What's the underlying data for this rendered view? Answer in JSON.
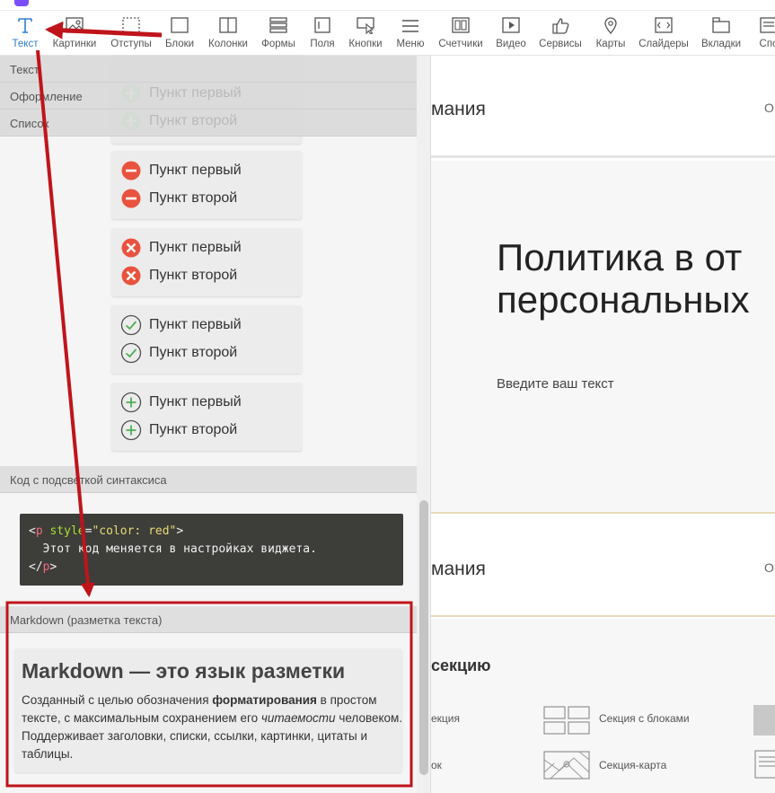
{
  "toolbar": {
    "items": [
      {
        "label": "Текст",
        "icon": "text-icon"
      },
      {
        "label": "Картинки",
        "icon": "image-icon"
      },
      {
        "label": "Отступы",
        "icon": "spacing-icon"
      },
      {
        "label": "Блоки",
        "icon": "block-icon"
      },
      {
        "label": "Колонки",
        "icon": "columns-icon"
      },
      {
        "label": "Формы",
        "icon": "form-icon"
      },
      {
        "label": "Поля",
        "icon": "field-icon"
      },
      {
        "label": "Кнопки",
        "icon": "button-icon"
      },
      {
        "label": "Меню",
        "icon": "menu-icon"
      },
      {
        "label": "Счетчики",
        "icon": "counter-icon"
      },
      {
        "label": "Видео",
        "icon": "video-icon"
      },
      {
        "label": "Сервисы",
        "icon": "thumbs-up-icon"
      },
      {
        "label": "Карты",
        "icon": "map-pin-icon"
      },
      {
        "label": "Слайдеры",
        "icon": "slider-icon"
      },
      {
        "label": "Вкладки",
        "icon": "tabs-icon"
      },
      {
        "label": "Спо",
        "icon": "list-icon"
      }
    ],
    "active_color": "#2d7fd1"
  },
  "panel": {
    "categories": [
      "Текст",
      "Оформление",
      "Список"
    ],
    "lists": [
      {
        "style": "plus-icon",
        "items": [
          "Пункт первый",
          "Пункт второй"
        ]
      },
      {
        "style": "minus-circle-icon",
        "items": [
          "Пункт первый",
          "Пункт второй"
        ]
      },
      {
        "style": "cross-circle-icon",
        "items": [
          "Пункт первый",
          "Пункт второй"
        ]
      },
      {
        "style": "check-circle-icon",
        "items": [
          "Пункт первый",
          "Пункт второй"
        ]
      },
      {
        "style": "plus-circle-icon",
        "items": [
          "Пункт первый",
          "Пункт второй"
        ]
      }
    ],
    "code_section": {
      "title": "Код с подсветкой синтаксиса",
      "line1": {
        "open": "<",
        "tag": "p",
        "attr": " style",
        "eq": "=",
        "value": "\"color: red\"",
        "close": ">"
      },
      "line2": "  Этот код меняется в настройках виджета.",
      "line3": {
        "open": "</",
        "tag": "p",
        "close": ">"
      }
    },
    "markdown_section": {
      "title": "Markdown (разметка текста)",
      "heading": "Markdown — это язык разметки",
      "body_part1": "Созданный с целью обозначения ",
      "body_bold": "форматирования",
      "body_part2": " в простом тексте, с максимальным сохранением его ",
      "body_italic": "читаемости",
      "body_part3": " человеком. Поддерживает заголовки, списки, ссылки, картинки, цитаты и таблицы."
    }
  },
  "preview": {
    "header_text": "мания",
    "header_letter": "О",
    "section_heading_line1": "Политика в от",
    "section_heading_line2": "персональных",
    "section_text": "Введите ваш текст",
    "header2_text": "мания",
    "header2_letter": "О",
    "add_title": "секцию",
    "add_items": [
      "екция",
      "Секция с блоками",
      "ок",
      "Секция-карта"
    ]
  },
  "annotation_color": "#c0141b"
}
